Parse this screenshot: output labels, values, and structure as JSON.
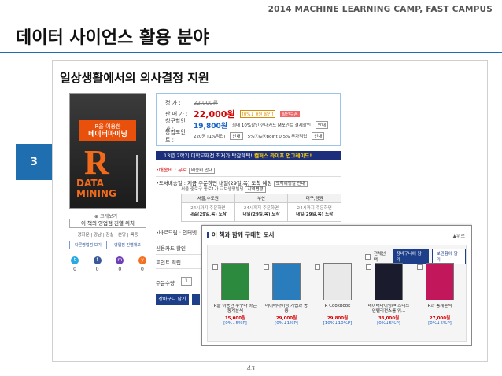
{
  "header": {
    "top": "2014 MACHINE LEARNING CAMP, FAST CAMPUS",
    "title": "데이터 사이언스 활용 분야"
  },
  "slide": {
    "number": "3",
    "subtitle": "일상생활에서의 의사결정 지원",
    "page": "43"
  },
  "book": {
    "badge_top": "R을 이용한",
    "badge_title": "데이터마이닝",
    "cover_r": "R",
    "cover_dm": "DATA MINING",
    "zoom": "크게보기",
    "location_title": "이 책의 영업점 진열 위치",
    "location_items": "광화문 | 강남 | 잠실 | 분당 | 목동",
    "location_btn1": "다른영업점 보기",
    "location_btn2": "영업점 진열재고",
    "social": [
      {
        "icon": "twitter-icon",
        "glyph": "t",
        "color": "#29a9e1",
        "count": "0"
      },
      {
        "icon": "facebook-icon",
        "glyph": "f",
        "color": "#3b5998",
        "count": "0"
      },
      {
        "icon": "me2day-icon",
        "glyph": "m",
        "color": "#6c3fb5",
        "count": "0"
      },
      {
        "icon": "yozm-icon",
        "glyph": "y",
        "color": "#f37021",
        "count": "0"
      }
    ]
  },
  "price": {
    "list_label": "정 가 :",
    "list_value": "22,000원",
    "sale_label": "판 매 가 :",
    "sale_value": "22,000원",
    "sale_tag1": "[0%↓ 0원 할인]",
    "sale_tag2": "할인쿠폰",
    "card_label": "청구할인가 :",
    "card_value": "19,800원",
    "card_note": "최대 10%할인 현대카드 M포인트 결제할인",
    "card_btn": "안내",
    "point_label": "통합포인트 :",
    "point_value": "220원 [1%적립]",
    "point_btn1": "안내",
    "point_note": "5%ⓢ&ⓦpoint 0.5% 추가적립",
    "point_btn2": "안내"
  },
  "banner": {
    "text": "13년 2학기 대학교재전 최저가 탁감혜택!",
    "highlight": "캠퍼스 라이프 업그레이드!"
  },
  "delivery": {
    "type_label": "•배송비 :",
    "type_value": "무료",
    "type_extra": "배송비 안내",
    "date_label": "•도서배송일 :",
    "date_value": "지금 주문하면 내일(29일,목) 도착 예정",
    "date_btn": "도착예정일 안내",
    "sub": "서울 중로구 종로1가 교보생명빌딩",
    "sub_btn": "지역변경",
    "regions": [
      {
        "name": "서울,수도권",
        "desc": "24시까지 주문하면",
        "value": "내일(29일,목) 도착"
      },
      {
        "name": "부산",
        "desc": "24시까지 주문하면",
        "value": "내일(29일,목) 도착"
      },
      {
        "name": "대구,경원",
        "desc": "24시까지 주문하면",
        "value": "내일(29일,목) 도착"
      }
    ]
  },
  "order": {
    "baro": "•바로드림 :",
    "baro_extra": "인터넷",
    "cards": [
      "신용카드 할인",
      "포인트 적립"
    ],
    "qty_label": "주문수량",
    "qty_value": "1",
    "cart_btn": "장바구니 담기"
  },
  "overlay": {
    "title": "이 책과 함께 구매한 도서",
    "close": "▲위로",
    "select_all": "전체선택",
    "cart_btn": "장바구니에 담기",
    "wish_btn": "보관함에 담기",
    "books": [
      {
        "title": "R을 이용한 누구나 하는 통계분석",
        "price": "15,000원",
        "disc": "[0%↓5%P]",
        "color": "#2b8a3e"
      },
      {
        "title": "데이터마이닝 기법과 응용",
        "price": "29,000원",
        "disc": "[0%↓1%P]",
        "color": "#2a7dbd"
      },
      {
        "title": "R Cookbook",
        "price": "29,800원",
        "disc": "[10%↓10%P]",
        "color": "#e9e9e9"
      },
      {
        "title": "데이터마이닝(비즈니스 인텔리전스를 위...",
        "price": "33,000원",
        "disc": "[0%↓5%P]",
        "color": "#1b1b2e"
      },
      {
        "title": "R과 통계분석",
        "price": "27,000원",
        "disc": "[0%↓5%P]",
        "color": "#c2185b"
      }
    ]
  }
}
